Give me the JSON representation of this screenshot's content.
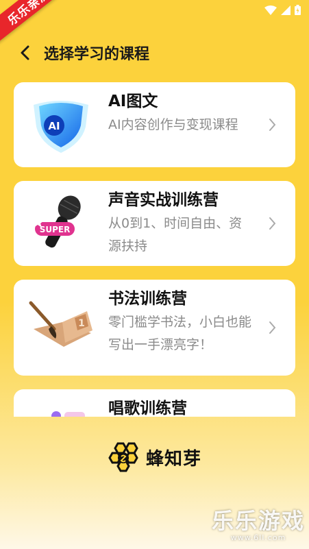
{
  "status_bar": {
    "icons": [
      "wifi-icon",
      "signal-icon",
      "battery-icon"
    ]
  },
  "ribbon": {
    "text": "乐乐亲测"
  },
  "header": {
    "back_icon": "chevron-left-icon",
    "title": "选择学习的课程"
  },
  "courses": [
    {
      "title": "AI图文",
      "description": "AI内容创作与变现课程",
      "icon": "ai-shield-icon"
    },
    {
      "title": "声音实战训练营",
      "description": "从0到1、时间自由、资源扶持",
      "icon": "microphone-icon"
    },
    {
      "title": "书法训练营",
      "description": "零门槛学书法，小白也能写出一手漂亮字！",
      "icon": "calligraphy-brush-icon"
    },
    {
      "title": "唱歌训练营",
      "description": "",
      "icon": "singing-icon"
    }
  ],
  "brand": {
    "logo_icon": "honeycomb-logo-icon",
    "name": "蜂知芽"
  },
  "watermark": {
    "text": "乐乐游戏",
    "url": "www.6ll.com"
  },
  "colors": {
    "background": "#fcd23c",
    "card": "#ffffff",
    "ribbon": "#e8262b"
  }
}
